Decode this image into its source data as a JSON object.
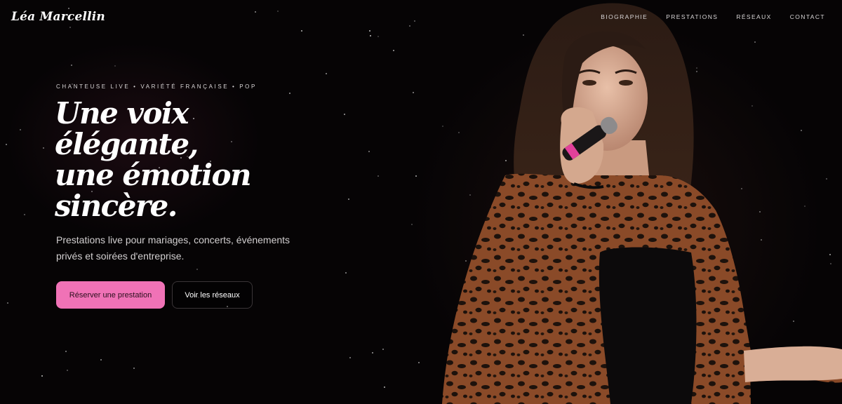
{
  "brand": {
    "name": "Léa Marcellin"
  },
  "nav": {
    "items": [
      {
        "label": "BIOGRAPHIE"
      },
      {
        "label": "PRESTATIONS"
      },
      {
        "label": "RÉSEAUX"
      },
      {
        "label": "CONTACT"
      }
    ]
  },
  "hero": {
    "eyebrow": "CHANTEUSE LIVE • VARIÉTÉ FRANÇAISE • POP",
    "headline_lines": [
      "Une voix",
      "élégante,",
      "une émotion",
      "sincère."
    ],
    "subtitle": "Prestations live pour mariages, concerts, événements privés et soirées d'entreprise.",
    "cta_primary": "Réserver une prestation",
    "cta_secondary": "Voir les réseaux"
  },
  "colors": {
    "background": "#060405",
    "accent_pink": "#f072b6",
    "text": "#ffffff"
  },
  "photo": {
    "subject": "singer-with-microphone",
    "jacket_pattern": "leopard"
  }
}
